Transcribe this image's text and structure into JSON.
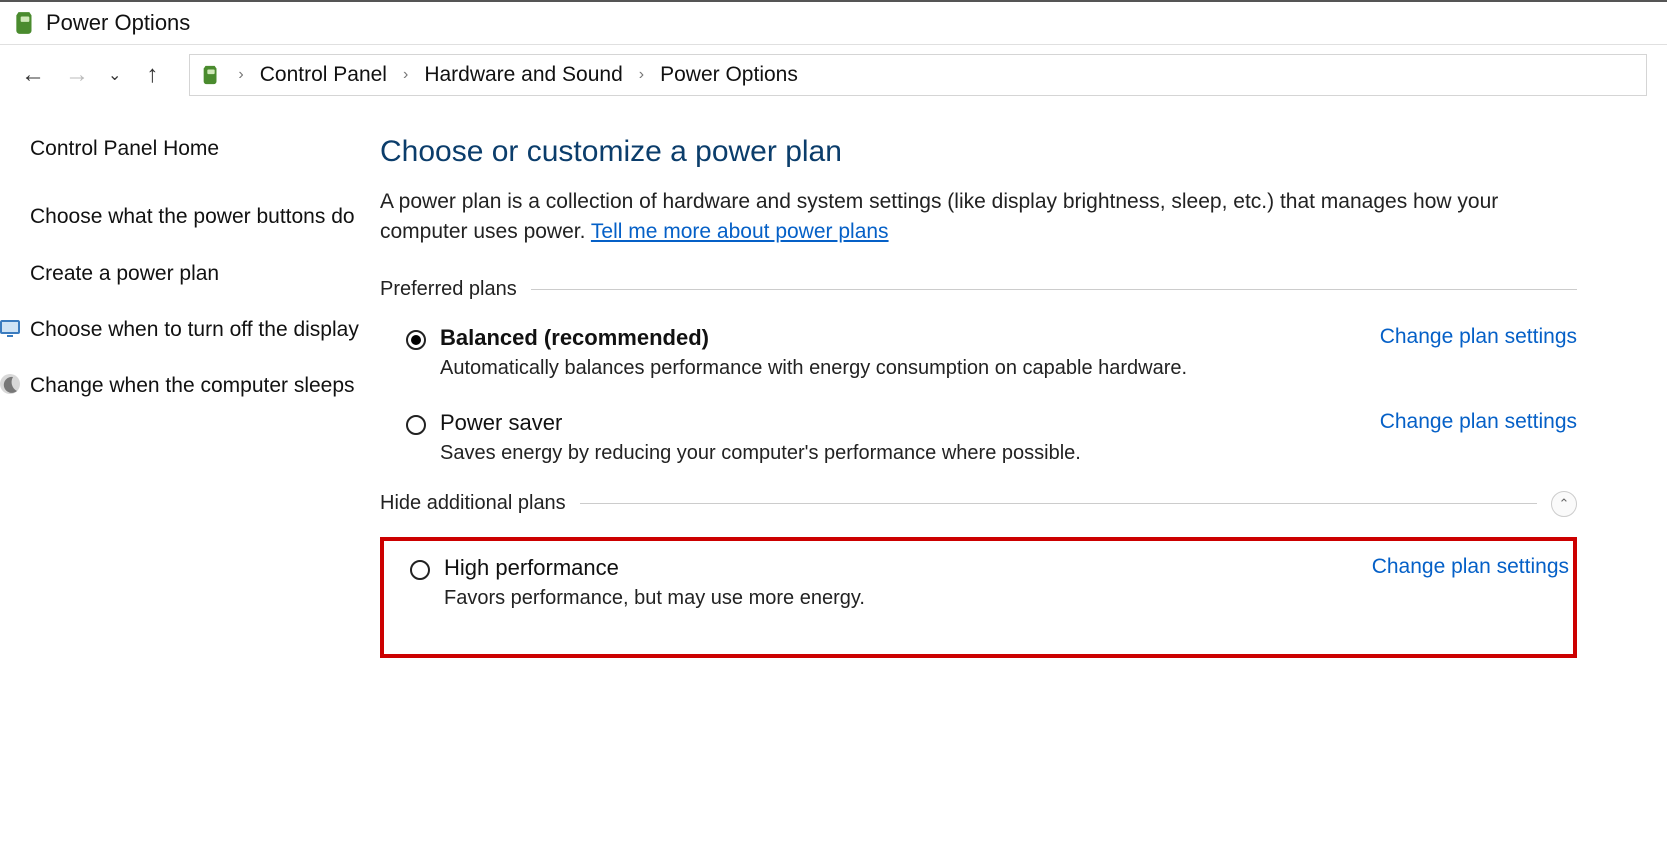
{
  "window": {
    "title": "Power Options"
  },
  "breadcrumb": {
    "items": [
      "Control Panel",
      "Hardware and Sound",
      "Power Options"
    ]
  },
  "sidebar": {
    "home": "Control Panel Home",
    "items": [
      {
        "label": "Choose what the power buttons do"
      },
      {
        "label": "Create a power plan"
      },
      {
        "label": "Choose when to turn off the display"
      },
      {
        "label": "Change when the computer sleeps"
      }
    ]
  },
  "content": {
    "heading": "Choose or customize a power plan",
    "description": "A power plan is a collection of hardware and system settings (like display brightness, sleep, etc.) that manages how your computer uses power. ",
    "more_link": "Tell me more about power plans",
    "preferred_label": "Preferred plans",
    "additional_label": "Hide additional plans",
    "change_link": "Change plan settings",
    "plans": {
      "balanced": {
        "title": "Balanced (recommended)",
        "desc": "Automatically balances performance with energy consumption on capable hardware."
      },
      "saver": {
        "title": "Power saver",
        "desc": "Saves energy by reducing your computer's performance where possible."
      },
      "high": {
        "title": "High performance",
        "desc": "Favors performance, but may use more energy."
      }
    }
  }
}
